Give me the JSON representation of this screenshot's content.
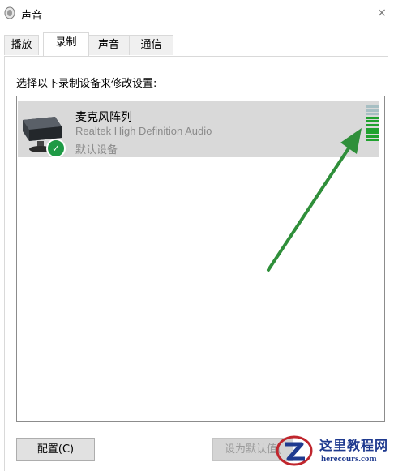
{
  "window": {
    "title": "声音",
    "close_glyph": "×",
    "icon": "speaker-icon"
  },
  "tabs": [
    {
      "label": "播放",
      "active": false
    },
    {
      "label": "录制",
      "active": true
    },
    {
      "label": "声音",
      "active": false
    },
    {
      "label": "通信",
      "active": false
    }
  ],
  "recording": {
    "instructions": "选择以下录制设备来修改设置:",
    "devices": [
      {
        "name": "麦克风阵列",
        "description": "Realtek High Definition Audio",
        "status": "默认设备",
        "selected": true,
        "default_badge": "✓",
        "level_fraction": 0.7
      }
    ]
  },
  "buttons": {
    "configure": "配置(C)",
    "set_default": "设为默认值("
  },
  "colors": {
    "arrow": "#2f8f3a",
    "level_active": "#1fa22e",
    "level_inactive": "#a7bfc3",
    "selection": "#d9d9d9"
  },
  "watermark": {
    "title": "这里教程网",
    "url": "herecours.com"
  }
}
